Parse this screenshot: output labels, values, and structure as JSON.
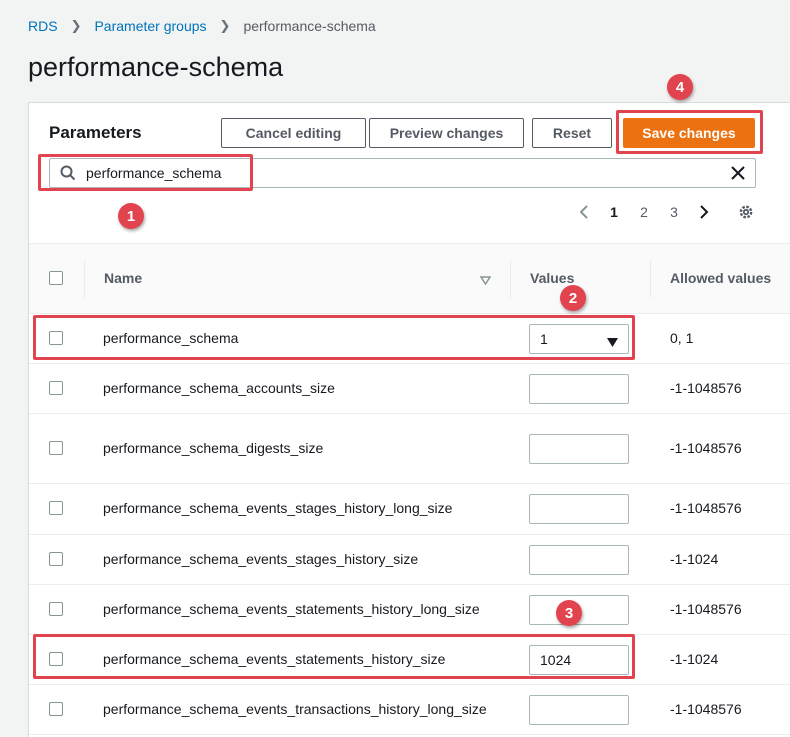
{
  "breadcrumb": {
    "items": [
      "RDS",
      "Parameter groups"
    ],
    "current": "performance-schema"
  },
  "page_title": "performance-schema",
  "parameters": {
    "title": "Parameters",
    "buttons": {
      "cancel": "Cancel editing",
      "preview": "Preview changes",
      "reset": "Reset",
      "save": "Save changes"
    },
    "search": {
      "value": "performance_schema"
    },
    "pagination": {
      "pages": [
        "1",
        "2",
        "3"
      ],
      "current_page": "1"
    },
    "columns": {
      "name": "Name",
      "values": "Values",
      "allowed": "Allowed values"
    },
    "rows": [
      {
        "name": "performance_schema",
        "value": "1",
        "allowed": "0, 1",
        "control": "select"
      },
      {
        "name": "performance_schema_accounts_size",
        "value": "",
        "allowed": "-1-1048576",
        "control": "input"
      },
      {
        "name": "performance_schema_digests_size",
        "value": "",
        "allowed": "-1-1048576",
        "control": "input"
      },
      {
        "name": "performance_schema_events_stages_history_long_size",
        "value": "",
        "allowed": "-1-1048576",
        "control": "input"
      },
      {
        "name": "performance_schema_events_stages_history_size",
        "value": "",
        "allowed": "-1-1024",
        "control": "input"
      },
      {
        "name": "performance_schema_events_statements_history_long_size",
        "value": "",
        "allowed": "-1-1048576",
        "control": "input"
      },
      {
        "name": "performance_schema_events_statements_history_size",
        "value": "1024",
        "allowed": "-1-1024",
        "control": "input"
      },
      {
        "name": "performance_schema_events_transactions_history_long_size",
        "value": "",
        "allowed": "-1-1048576",
        "control": "input"
      }
    ]
  },
  "annotations": [
    "1",
    "2",
    "3",
    "4"
  ],
  "colors": {
    "accent": "#ec7211",
    "link": "#0073bb",
    "annotation": "#e2444f"
  },
  "icons": {
    "search": "search-icon",
    "clear": "close-icon",
    "prev": "chevron-left-icon",
    "next": "chevron-right-icon",
    "settings": "gear-icon",
    "sort": "sort-down-icon",
    "dropdown": "caret-down-icon"
  }
}
